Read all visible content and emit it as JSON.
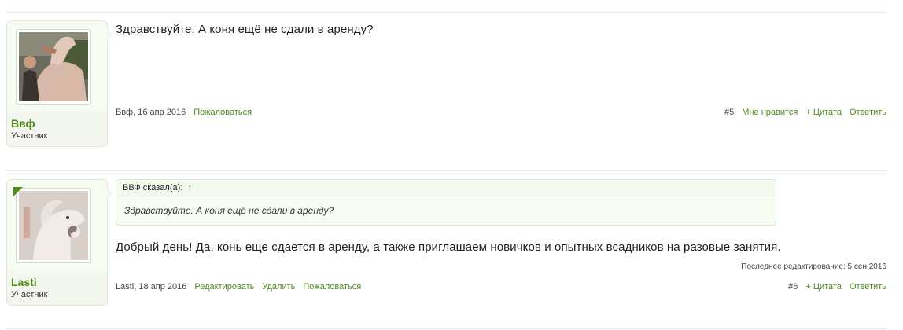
{
  "posts": [
    {
      "user": {
        "name": "Ввф",
        "role": "Участник",
        "avatar_icon": "user-with-horse-avatar"
      },
      "message": "Здравствуйте. А коня ещё не сдали в аренду?",
      "meta": {
        "author_date": "Ввф, 16 апр 2016",
        "report": "Пожаловаться"
      },
      "actions": {
        "number": "#5",
        "like": "Мне нравится",
        "quote": "+ Цитата",
        "reply": "Ответить"
      }
    },
    {
      "user": {
        "name": "Lasti",
        "role": "Участник",
        "avatar_icon": "white-horse-avatar"
      },
      "quote": {
        "author": "ВВФ сказал(а):",
        "up_icon": "↑",
        "text": "Здравствуйте. А коня ещё не сдали в аренду?"
      },
      "message": "Добрый день! Да, конь еще сдается в аренду, а также приглашаем новичков и опытных всадников на разовые занятия.",
      "edited": "Последнее редактирование: 5 сен 2016",
      "meta": {
        "author_date": "Lasti, 18 апр 2016",
        "edit": "Редактировать",
        "delete": "Удалить",
        "report": "Пожаловаться"
      },
      "actions": {
        "number": "#6",
        "quote": "+ Цитата",
        "reply": "Ответить"
      }
    }
  ],
  "colors": {
    "accent": "#4f8a1d",
    "card_bg": "#f3f7f0"
  }
}
